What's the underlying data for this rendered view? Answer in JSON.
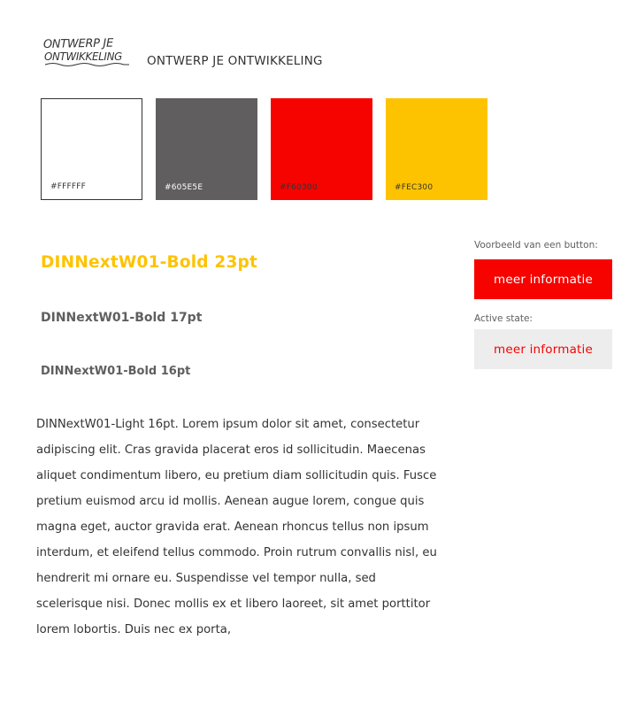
{
  "header": {
    "logo": {
      "icon": "handwritten-logo",
      "line1": "ONTWERP JE",
      "line2": "ONTWIKKELING"
    },
    "brand_name": "ONTWERP JE ONTWIKKELING"
  },
  "palette": [
    {
      "code": "#FFFFFF",
      "color": "#FFFFFF",
      "text_color": "#333333"
    },
    {
      "code": "#605E5E",
      "color": "#605E5E",
      "text_color": "#FFFFFF"
    },
    {
      "code": "#F60300",
      "color": "#F60300",
      "text_color": "#333333"
    },
    {
      "code": "#FEC300",
      "color": "#FEC300",
      "text_color": "#333333"
    }
  ],
  "typography": {
    "heading_23": "DINNextW01-Bold 23pt",
    "heading_17": "DINNextW01-Bold 17pt",
    "heading_16": "DINNextW01-Bold 16pt",
    "body": "DINNextW01-Light 16pt. Lorem ipsum dolor sit amet, consectetur adipiscing elit. Cras gravida placerat eros id sollicitudin. Maecenas aliquet condimentum libero, eu pretium diam sollicitudin quis. Fusce pretium euismod arcu id mollis. Aenean augue lorem, congue quis magna eget, auctor gravida erat. Aenean rhoncus tellus non ipsum interdum, et eleifend tellus commodo. Proin rutrum convallis nisl, eu hendrerit mi ornare eu. Suspendisse vel tempor nulla, sed scelerisque nisi. Donec mollis ex et libero laoreet, sit amet porttitor lorem lobortis. Duis nec ex porta,"
  },
  "buttons": {
    "example_label": "Voorbeeld van een button:",
    "example_button": "meer informatie",
    "active_label": "Active state:",
    "active_button": "meer informatie"
  },
  "colors": {
    "accent_yellow": "#FEC300",
    "accent_red": "#F60300",
    "gray": "#605E5E",
    "active_bg": "#EDEDED"
  }
}
